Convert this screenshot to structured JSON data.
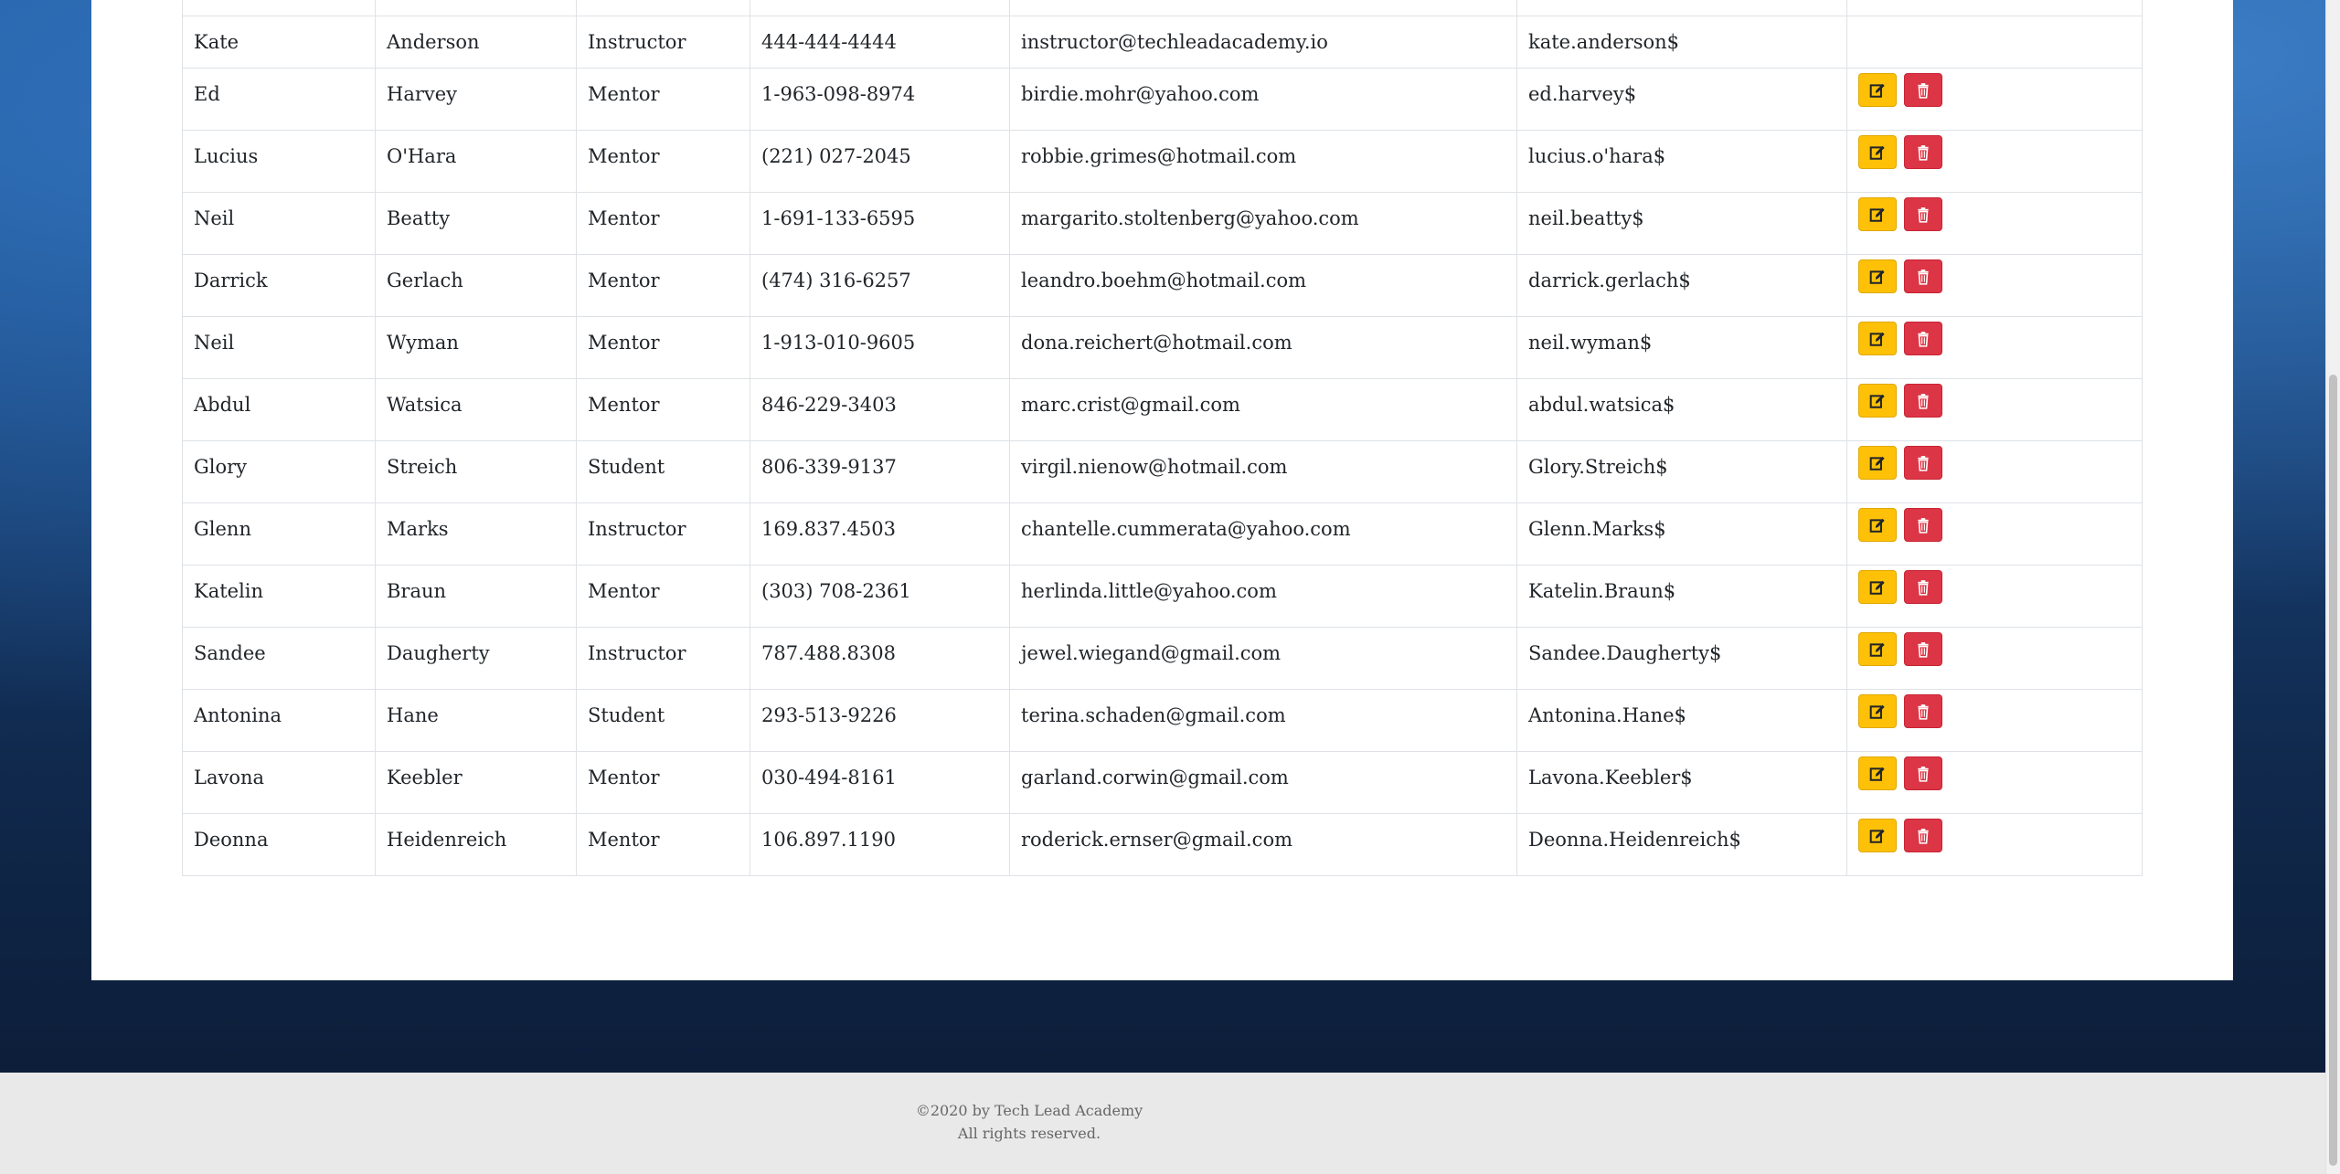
{
  "table": {
    "rows": [
      {
        "first": "Kate",
        "last": "Anderson",
        "role": "Instructor",
        "phone": "444-444-4444",
        "email": "instructor@techleadacademy.io",
        "username": "kate.anderson$",
        "actions": false
      },
      {
        "first": "Ed",
        "last": "Harvey",
        "role": "Mentor",
        "phone": "1-963-098-8974",
        "email": "birdie.mohr@yahoo.com",
        "username": "ed.harvey$",
        "actions": true
      },
      {
        "first": "Lucius",
        "last": "O'Hara",
        "role": "Mentor",
        "phone": "(221) 027-2045",
        "email": "robbie.grimes@hotmail.com",
        "username": "lucius.o'hara$",
        "actions": true
      },
      {
        "first": "Neil",
        "last": "Beatty",
        "role": "Mentor",
        "phone": "1-691-133-6595",
        "email": "margarito.stoltenberg@yahoo.com",
        "username": "neil.beatty$",
        "actions": true
      },
      {
        "first": "Darrick",
        "last": "Gerlach",
        "role": "Mentor",
        "phone": "(474) 316-6257",
        "email": "leandro.boehm@hotmail.com",
        "username": "darrick.gerlach$",
        "actions": true
      },
      {
        "first": "Neil",
        "last": "Wyman",
        "role": "Mentor",
        "phone": "1-913-010-9605",
        "email": "dona.reichert@hotmail.com",
        "username": "neil.wyman$",
        "actions": true
      },
      {
        "first": "Abdul",
        "last": "Watsica",
        "role": "Mentor",
        "phone": "846-229-3403",
        "email": "marc.crist@gmail.com",
        "username": "abdul.watsica$",
        "actions": true
      },
      {
        "first": "Glory",
        "last": "Streich",
        "role": "Student",
        "phone": "806-339-9137",
        "email": "virgil.nienow@hotmail.com",
        "username": "Glory.Streich$",
        "actions": true
      },
      {
        "first": "Glenn",
        "last": "Marks",
        "role": "Instructor",
        "phone": "169.837.4503",
        "email": "chantelle.cummerata@yahoo.com",
        "username": "Glenn.Marks$",
        "actions": true
      },
      {
        "first": "Katelin",
        "last": "Braun",
        "role": "Mentor",
        "phone": "(303) 708-2361",
        "email": "herlinda.little@yahoo.com",
        "username": "Katelin.Braun$",
        "actions": true
      },
      {
        "first": "Sandee",
        "last": "Daugherty",
        "role": "Instructor",
        "phone": "787.488.8308",
        "email": "jewel.wiegand@gmail.com",
        "username": "Sandee.Daugherty$",
        "actions": true
      },
      {
        "first": "Antonina",
        "last": "Hane",
        "role": "Student",
        "phone": "293-513-9226",
        "email": "terina.schaden@gmail.com",
        "username": "Antonina.Hane$",
        "actions": true
      },
      {
        "first": "Lavona",
        "last": "Keebler",
        "role": "Mentor",
        "phone": "030-494-8161",
        "email": "garland.corwin@gmail.com",
        "username": "Lavona.Keebler$",
        "actions": true
      },
      {
        "first": "Deonna",
        "last": "Heidenreich",
        "role": "Mentor",
        "phone": "106.897.1190",
        "email": "roderick.ernser@gmail.com",
        "username": "Deonna.Heidenreich$",
        "actions": true
      }
    ],
    "icons": {
      "edit": "edit-icon",
      "delete": "trash-icon"
    }
  },
  "colors": {
    "edit_button": "#ffc107",
    "delete_button": "#dc3545",
    "background_top": "#1f5a9e",
    "background_bottom": "#0b1a33"
  },
  "footer": {
    "copyright": "©2020 by Tech Lead Academy",
    "rights": "All rights reserved."
  }
}
